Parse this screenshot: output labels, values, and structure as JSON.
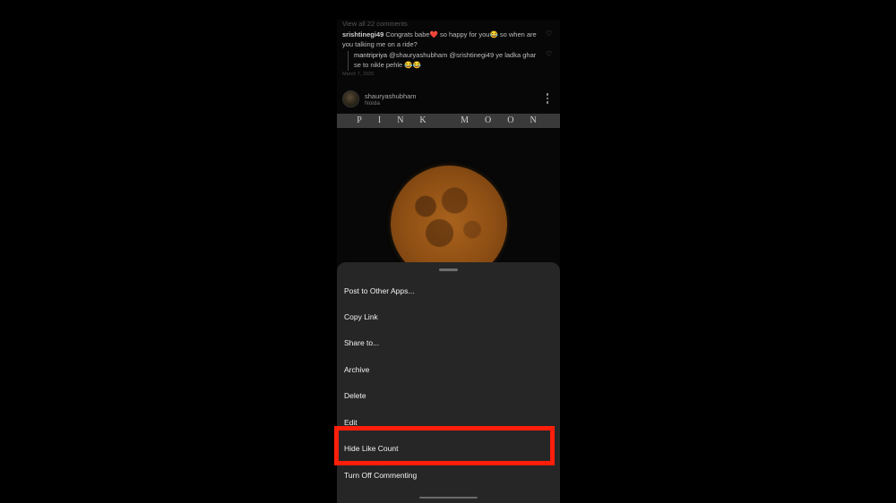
{
  "feed": {
    "view_all_comments": "View all 22 comments",
    "comment": {
      "username": "srishtinegi49",
      "text": " Congrats babe❤️ so happy for you😂 so when are you talking me on a ride?"
    },
    "reply": {
      "username": "mantripriya",
      "text": " @shauryashubham @srishtinegi49 ye ladka ghar se to nikle pehle 😂😂"
    },
    "date": "March 7, 2020",
    "post": {
      "username": "shauryashubham",
      "location": "Noida",
      "banner_text": "PINK MOON"
    }
  },
  "sheet": {
    "items": [
      {
        "label": "Post to Other Apps..."
      },
      {
        "label": "Copy Link"
      },
      {
        "label": "Share to..."
      },
      {
        "label": "Archive"
      },
      {
        "label": "Delete"
      },
      {
        "label": "Edit"
      },
      {
        "label": "Hide Like Count"
      },
      {
        "label": "Turn Off Commenting"
      }
    ],
    "highlighted_item": "Hide Like Count",
    "highlight_color": "#ff1e0a"
  },
  "icons": [
    "heart-icon",
    "more-options-icon"
  ]
}
